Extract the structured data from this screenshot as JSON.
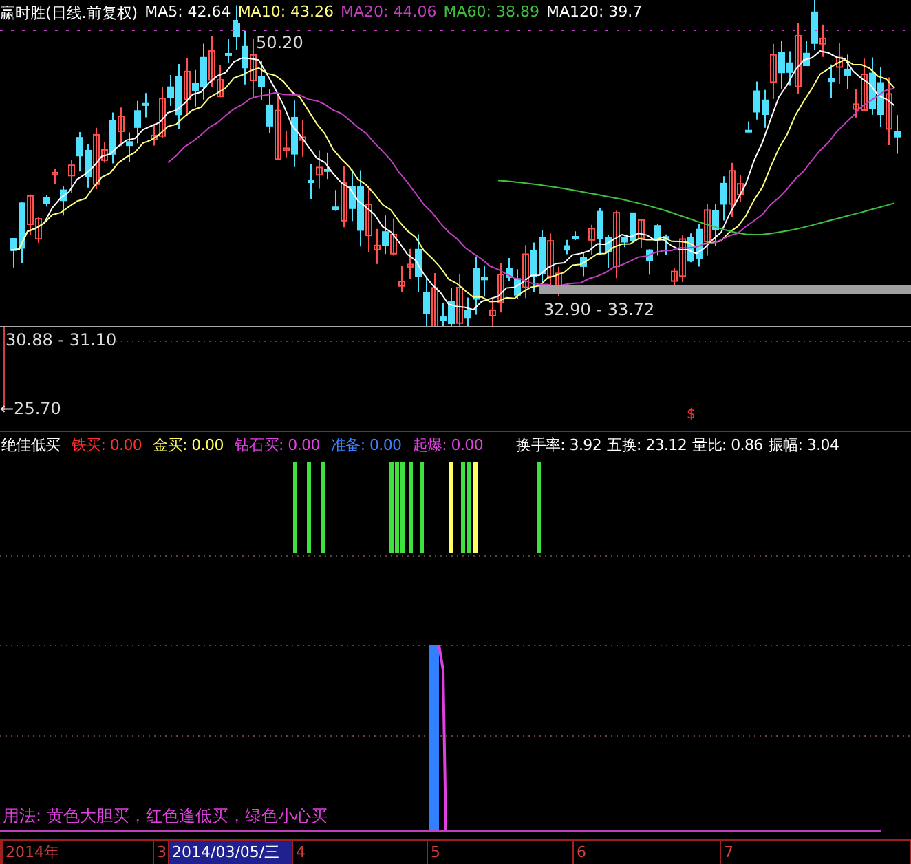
{
  "header": {
    "title": "赢时胜(日线.前复权)",
    "ma": [
      {
        "label": "MA5: 42.64",
        "color": "#ffffff"
      },
      {
        "label": "MA10: 43.26",
        "color": "#ffff80"
      },
      {
        "label": "MA20: 44.06",
        "color": "#c040c0"
      },
      {
        "label": "MA60: 38.89",
        "color": "#40c040"
      },
      {
        "label": "MA120: 39.7",
        "color": "#ffffff"
      }
    ]
  },
  "price_labels": {
    "high": "50.20",
    "range": "32.90 - 33.72"
  },
  "volume_panel": {
    "top_label": "30.88 - 31.10",
    "bottom_label": "←25.70",
    "marker": "$"
  },
  "indicator": {
    "name": "绝佳低买",
    "items": [
      {
        "label": "铁买:",
        "value": "0.00",
        "color": "#ff3030"
      },
      {
        "label": "金买:",
        "value": "0.00",
        "color": "#ffff60"
      },
      {
        "label": "钻石买:",
        "value": "0.00",
        "color": "#e040e0"
      },
      {
        "label": "准备:",
        "value": "0.00",
        "color": "#4080ff"
      },
      {
        "label": "起爆:",
        "value": "0.00",
        "color": "#e040e0"
      }
    ],
    "stats": [
      "换手率: 3.92",
      "五换: 23.12",
      "量比: 0.86",
      "振幅: 3.04"
    ]
  },
  "legend": "用法: 黄色大胆买，红色逢低买，绿色小心买",
  "date_axis": [
    {
      "label": "2014年",
      "selected": false
    },
    {
      "label": "3",
      "selected": false
    },
    {
      "label": "2014/03/05/三",
      "selected": true
    },
    {
      "label": "4",
      "selected": false
    },
    {
      "label": "5",
      "selected": false
    },
    {
      "label": "6",
      "selected": false
    },
    {
      "label": "7",
      "selected": false
    }
  ]
}
